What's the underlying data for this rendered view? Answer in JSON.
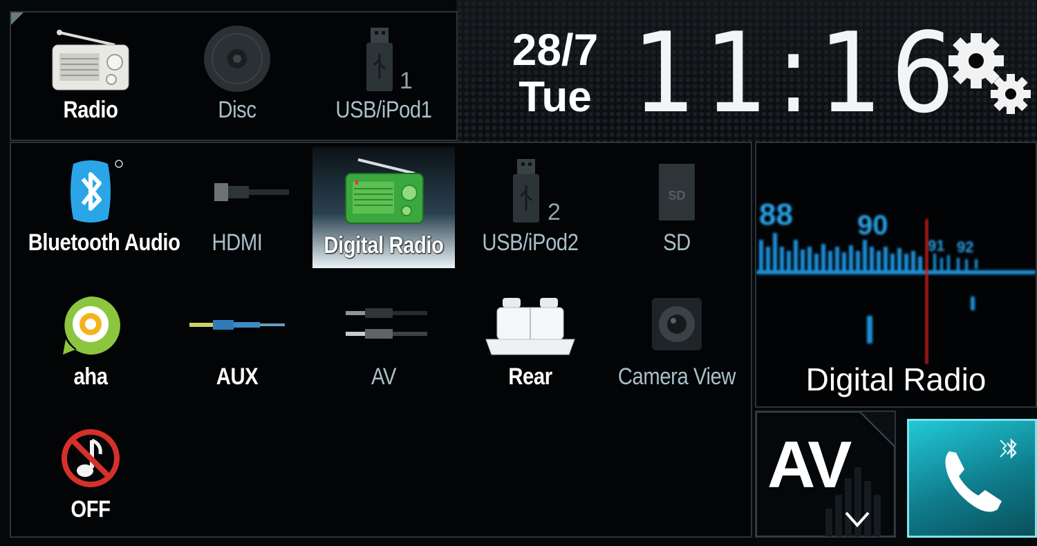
{
  "header": {
    "date": "28/7",
    "weekday": "Tue",
    "time": "11:16"
  },
  "top_sources": [
    {
      "label": "Radio",
      "icon": "radio-icon"
    },
    {
      "label": "Disc",
      "icon": "disc-icon"
    },
    {
      "label": "USB/iPod1",
      "icon": "usb-icon",
      "badge": "1"
    }
  ],
  "sources": [
    {
      "label": "Bluetooth Audio",
      "icon": "bluetooth-icon"
    },
    {
      "label": "HDMI",
      "icon": "hdmi-icon"
    },
    {
      "label": "Digital Radio",
      "icon": "digital-radio-icon",
      "selected": true
    },
    {
      "label": "USB/iPod2",
      "icon": "usb-icon",
      "badge": "2"
    },
    {
      "label": "SD",
      "icon": "sd-card-icon"
    },
    {
      "label": "aha",
      "icon": "aha-icon"
    },
    {
      "label": "AUX",
      "icon": "aux-cable-icon"
    },
    {
      "label": "AV",
      "icon": "av-cable-icon"
    },
    {
      "label": "Rear",
      "icon": "rear-seats-icon"
    },
    {
      "label": "Camera View",
      "icon": "camera-icon"
    },
    {
      "label": "OFF",
      "icon": "audio-off-icon"
    }
  ],
  "now_playing": {
    "title": "Digital Radio",
    "scale_labels": [
      "88",
      "90",
      "91",
      "92"
    ]
  },
  "buttons": {
    "av": "AV"
  },
  "colors": {
    "accent_cyan": "#22c9d8",
    "tuner_blue": "#1d8fd6",
    "needle_red": "#d21a1a",
    "selected_green": "#3aa83e"
  }
}
